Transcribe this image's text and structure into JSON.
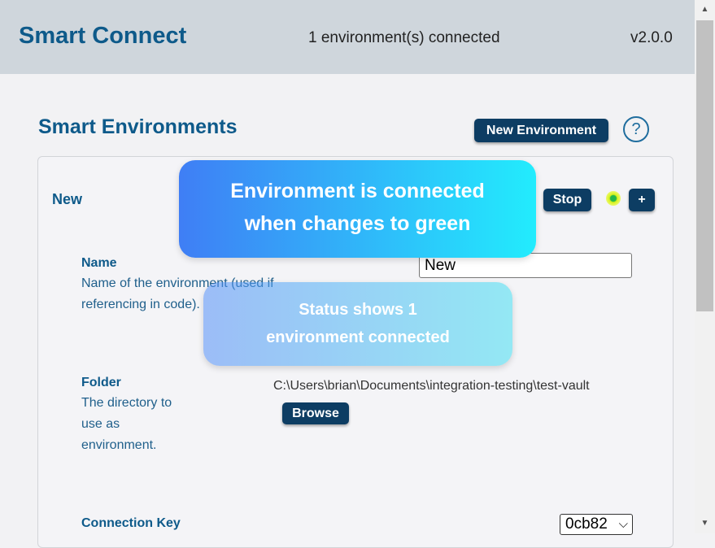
{
  "header": {
    "app_title": "Smart Connect",
    "status": "1 environment(s) connected",
    "version": "v2.0.0"
  },
  "section": {
    "title": "Smart Environments",
    "new_environment_label": "New Environment",
    "help_icon": "?"
  },
  "environment": {
    "name": "New",
    "stop_label": "Stop",
    "add_label": "+",
    "status_color": "#22b84a",
    "fields": {
      "name": {
        "label": "Name",
        "description": "Name of the environment (used if referencing in code).",
        "value": "New"
      },
      "folder": {
        "label": "Folder",
        "description": "The directory to use as environment.",
        "path": "C:\\Users\\brian\\Documents\\integration-testing\\test-vault",
        "browse_label": "Browse"
      },
      "connection_key": {
        "label": "Connection Key",
        "selected": "0cb82"
      }
    }
  },
  "callouts": {
    "connected_line1": "Environment is connected",
    "connected_line2": "when changes to green",
    "status_line1": "Status shows 1",
    "status_line2": "environment connected"
  },
  "colors": {
    "header_bg": "#cfd6dc",
    "button_bg": "#0d3d63",
    "title_color": "#0e5a8a"
  }
}
